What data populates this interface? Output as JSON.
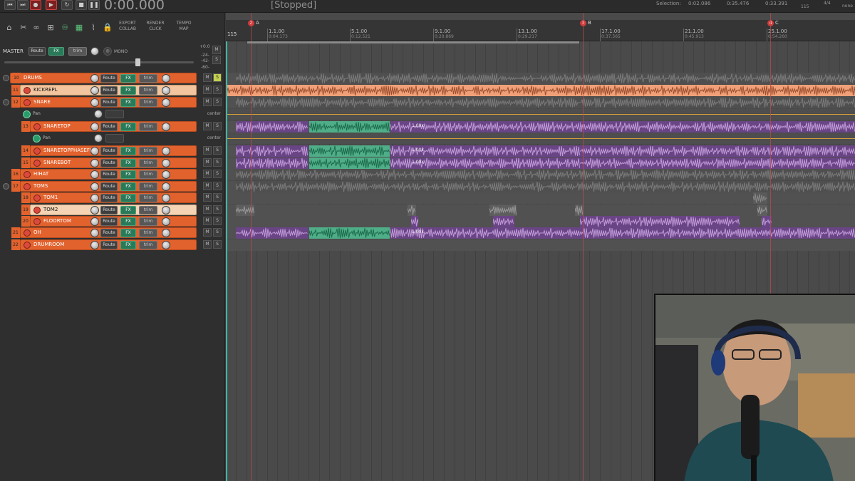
{
  "transport": {
    "time": "0:00.000",
    "status": "[Stopped]",
    "selection_label": "Selection:",
    "sel_start": "0:02.086",
    "sel_end": "0:35.476",
    "sel_len": "0:33.391",
    "bpm": "115",
    "timesig": "4/4",
    "none": "none"
  },
  "toolbar": {
    "export": "EXPORT",
    "collab": "COLLAB",
    "render": "RENDER",
    "click": "CLICK",
    "tempo": "TEMPO",
    "map": "MAP"
  },
  "master": {
    "label": "MASTER",
    "route": "Route",
    "fx": "FX",
    "trim": "trim",
    "mono": "MONO",
    "db1": "+0.0",
    "db2": "-24-",
    "db3": "-42-",
    "db4": "-60-"
  },
  "common": {
    "route": "Route",
    "fx": "FX",
    "trim": "trim",
    "m": "M",
    "s": "S",
    "pan": "Pan",
    "center": "center"
  },
  "tracks": [
    {
      "num": "10",
      "name": "DRUMS"
    },
    {
      "num": "11",
      "name": "KICKREPL"
    },
    {
      "num": "12",
      "name": "SNARE"
    },
    {
      "num": "13",
      "name": "SNARETOP"
    },
    {
      "num": "14",
      "name": "SNARETOPPHASEFIX"
    },
    {
      "num": "15",
      "name": "SNAREBOT"
    },
    {
      "num": "16",
      "name": "HIHAT"
    },
    {
      "num": "17",
      "name": "TOMS"
    },
    {
      "num": "18",
      "name": "TOM1"
    },
    {
      "num": "19",
      "name": "TOM2"
    },
    {
      "num": "20",
      "name": "FLOORTOM"
    },
    {
      "num": "21",
      "name": "OH"
    },
    {
      "num": "22",
      "name": "DRUMROOM"
    }
  ],
  "ruler": {
    "start": "115",
    "markers": [
      {
        "id": "2",
        "label": "A"
      },
      {
        "id": "3",
        "label": "B"
      },
      {
        "id": "4",
        "label": "C"
      }
    ],
    "bars": [
      {
        "bar": "1.1.00",
        "time": "0:04.173"
      },
      {
        "bar": "5.1.00",
        "time": "0:12.521"
      },
      {
        "bar": "9.1.00",
        "time": "0:20.869"
      },
      {
        "bar": "13.1.00",
        "time": "0:29.217"
      },
      {
        "bar": "17.1.00",
        "time": "0:37.565"
      },
      {
        "bar": "21.1.00",
        "time": "0:45.913"
      },
      {
        "bar": "25.1.00",
        "time": "0:54.260"
      }
    ]
  },
  "item_labels": {
    "rate": "1.00x"
  },
  "colors": {
    "track": "#e2622e",
    "purple": "#7d4fa0",
    "green": "#55c29a",
    "salmon": "#f0a078"
  }
}
